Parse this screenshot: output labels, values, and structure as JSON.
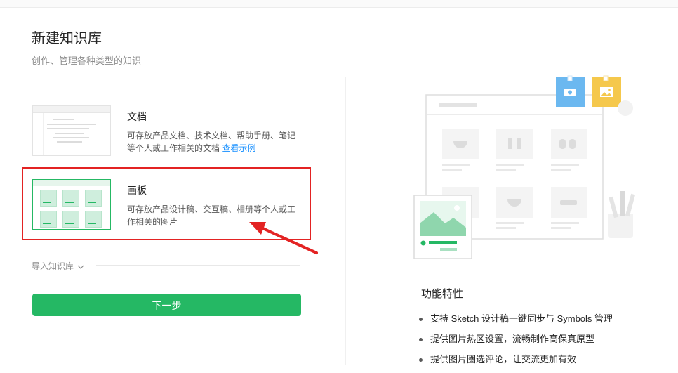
{
  "header": {
    "title": "新建知识库",
    "subtitle": "创作、管理各种类型的知识"
  },
  "options": [
    {
      "id": "doc",
      "title": "文档",
      "description": "可存放产品文档、技术文档、帮助手册、笔记等个人或工作相关的文档",
      "link_text": "查看示例",
      "selected": false
    },
    {
      "id": "board",
      "title": "画板",
      "description": "可存放产品设计稿、交互稿、相册等个人或工作相关的图片",
      "selected": true
    }
  ],
  "import": {
    "label": "导入知识库",
    "icon": "chevron-down-icon"
  },
  "next_button": {
    "label": "下一步"
  },
  "features": {
    "title": "功能特性",
    "items": [
      "支持 Sketch 设计稿一键同步与 Symbols 管理",
      "提供图片热区设置，流畅制作高保真原型",
      "提供图片圈选评论，让交流更加有效"
    ]
  },
  "colors": {
    "primary": "#25b864",
    "annotation_red": "#e32323",
    "link": "#1890ff",
    "camera_tag": "#6bb8f0",
    "image_tag": "#f5c84c"
  }
}
